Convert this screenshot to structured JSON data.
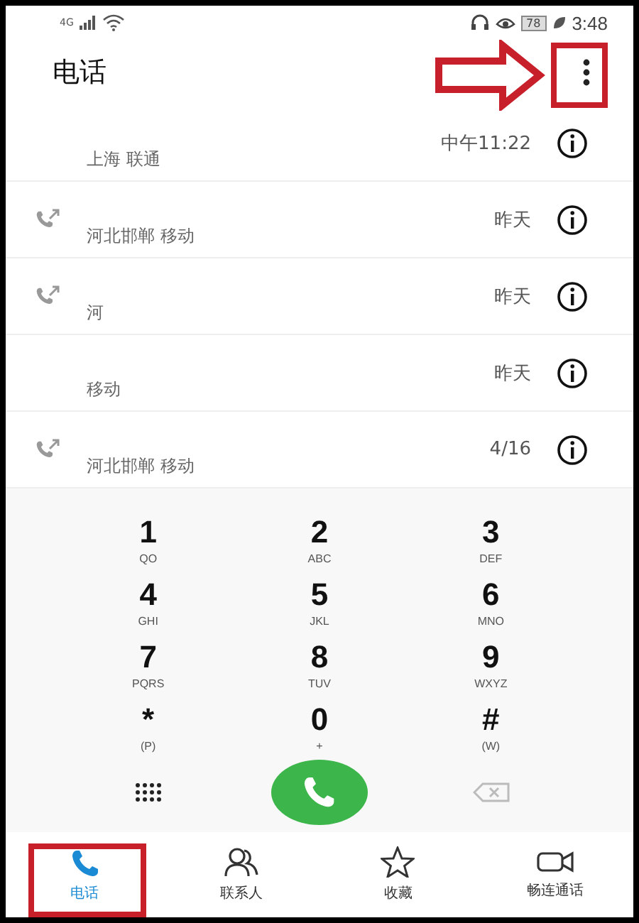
{
  "status_bar": {
    "network": "4G",
    "battery": "78",
    "time": "3:48"
  },
  "header": {
    "title": "电话",
    "menu_highlighted": true
  },
  "calls": [
    {
      "location": "上海 联通",
      "time": "中午11:22",
      "outgoing": false
    },
    {
      "location": "河北邯郸 移动",
      "time": "昨天",
      "outgoing": true
    },
    {
      "location": "河",
      "time": "昨天",
      "outgoing": true
    },
    {
      "location": "移动",
      "time": "昨天",
      "outgoing": false
    },
    {
      "location": "河北邯郸 移动",
      "time": "4/16",
      "outgoing": true
    }
  ],
  "keypad": [
    {
      "digit": "1",
      "letters": "QO"
    },
    {
      "digit": "2",
      "letters": "ABC"
    },
    {
      "digit": "3",
      "letters": "DEF"
    },
    {
      "digit": "4",
      "letters": "GHI"
    },
    {
      "digit": "5",
      "letters": "JKL"
    },
    {
      "digit": "6",
      "letters": "MNO"
    },
    {
      "digit": "7",
      "letters": "PQRS"
    },
    {
      "digit": "8",
      "letters": "TUV"
    },
    {
      "digit": "9",
      "letters": "WXYZ"
    },
    {
      "digit": "*",
      "letters": "(P)"
    },
    {
      "digit": "0",
      "letters": "+"
    },
    {
      "digit": "#",
      "letters": "(W)"
    }
  ],
  "tabs": [
    {
      "label": "电话",
      "kind": "phone",
      "selected": true,
      "highlighted": true
    },
    {
      "label": "联系人",
      "kind": "contacts",
      "selected": false,
      "highlighted": false
    },
    {
      "label": "收藏",
      "kind": "star",
      "selected": false,
      "highlighted": false
    },
    {
      "label": "畅连通话",
      "kind": "video",
      "selected": false,
      "highlighted": false
    }
  ]
}
